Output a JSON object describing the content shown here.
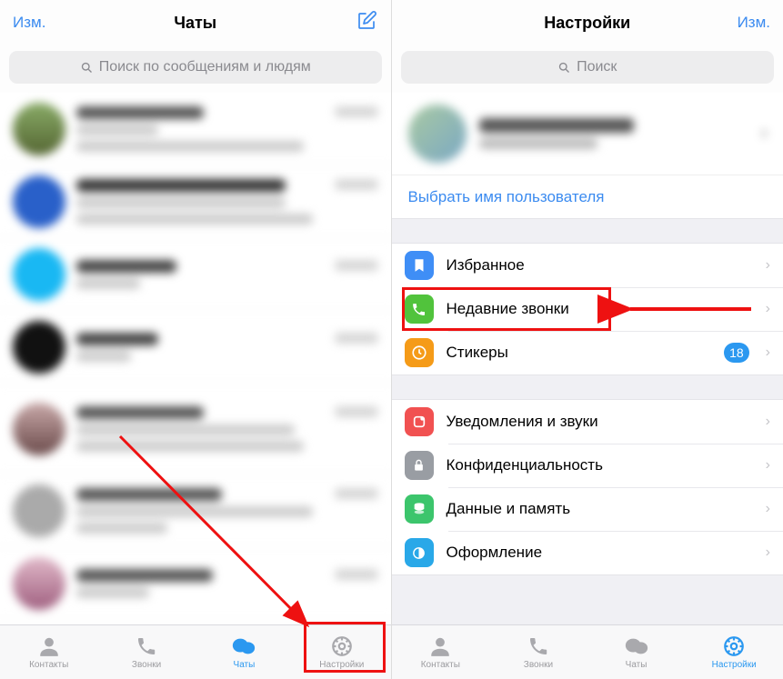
{
  "left": {
    "header": {
      "edit": "Изм.",
      "title": "Чаты"
    },
    "search_placeholder": "Поиск по сообщениям и людям",
    "tabs": {
      "contacts": "Контакты",
      "calls": "Звонки",
      "chats": "Чаты",
      "settings": "Настройки"
    }
  },
  "right": {
    "header": {
      "edit": "Изм.",
      "title": "Настройки"
    },
    "search_placeholder": "Поиск",
    "username_row": "Выбрать имя пользователя",
    "cells": {
      "favorites": "Избранное",
      "recent_calls": "Недавние звонки",
      "stickers": "Стикеры",
      "stickers_badge": "18",
      "notifications": "Уведомления и звуки",
      "privacy": "Конфиденциальность",
      "data": "Данные и память",
      "appearance": "Оформление"
    },
    "tabs": {
      "contacts": "Контакты",
      "calls": "Звонки",
      "chats": "Чаты",
      "settings": "Настройки"
    }
  }
}
